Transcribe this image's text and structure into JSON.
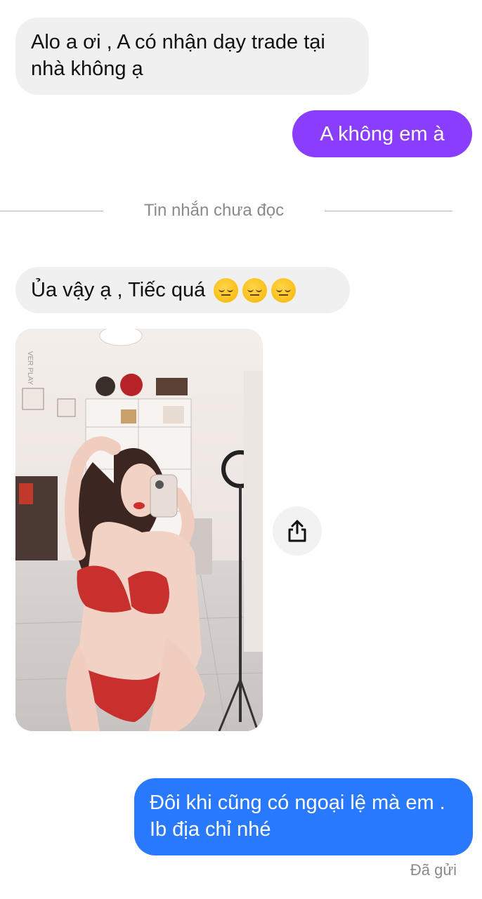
{
  "messages": [
    {
      "text": "Alo a ơi , A có nhận dạy trade tại nhà không ạ",
      "direction": "incoming"
    },
    {
      "text": "A không em à",
      "direction": "outgoing"
    },
    {
      "text": "Ủa vậy ạ , Tiếc quá",
      "direction": "incoming",
      "emojis": [
        "pensive-face-icon",
        "pensive-face-icon",
        "pensive-face-icon"
      ]
    },
    {
      "text": "Đôi khi cũng có ngoại lệ mà em . Ib địa chỉ nhé",
      "direction": "outgoing"
    }
  ],
  "divider": {
    "label": "Tin nhắn chưa đọc"
  },
  "image_watermark": "VER PLAY",
  "status": {
    "label": "Đã gửi"
  },
  "colors": {
    "incoming_bubble": "#f0f0f0",
    "outgoing_purple": "#8a3dff",
    "outgoing_blue": "#2979ff",
    "muted_text": "#8a8a8a"
  }
}
